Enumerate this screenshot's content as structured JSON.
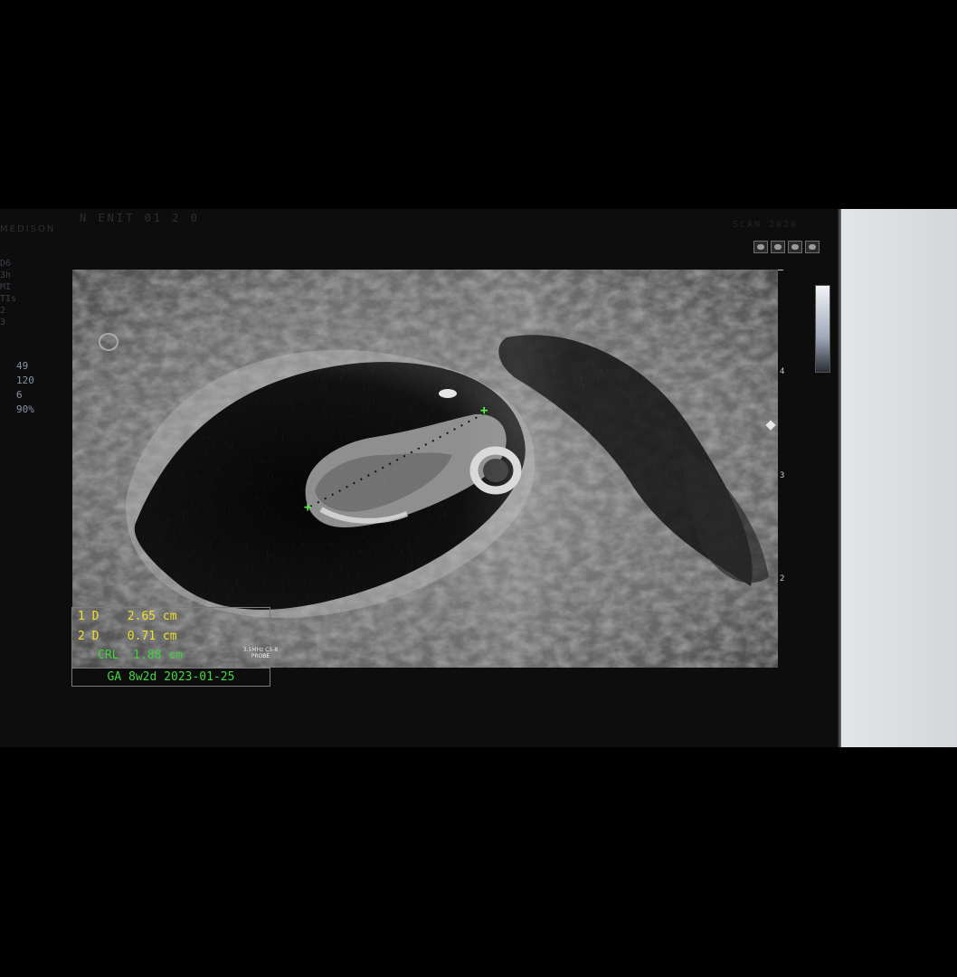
{
  "header": {
    "title": "N ENIT 01 2 0",
    "brand": "MEDISON",
    "right_label": "SCAN 2020"
  },
  "left_marks": [
    "D6",
    "3h",
    "MI",
    "TIs",
    "2",
    "3"
  ],
  "params": [
    "49",
    "120",
    "6",
    "90%"
  ],
  "depth_scale": {
    "labels": [
      "4",
      "3",
      "2"
    ],
    "label_positions_fraction": [
      0.26,
      0.52,
      0.78
    ]
  },
  "measurements": {
    "rows": [
      {
        "index": "1",
        "kind": "D",
        "value": "2.65 cm"
      },
      {
        "index": "2",
        "kind": "D",
        "value": "0.71 cm"
      }
    ],
    "crl": {
      "label": "CRL",
      "value": "1.88 cm"
    },
    "ga": "GA 8w2d 2023-01-25"
  },
  "small_label": "3.5MHz C5-8 PROBE",
  "toolbar_icons": [
    "freeze-icon",
    "image-icon",
    "measure-icon",
    "settings-icon"
  ],
  "colors": {
    "measure_yellow": "#f0e02a",
    "measure_green": "#3fd23a",
    "background": "#000000"
  }
}
